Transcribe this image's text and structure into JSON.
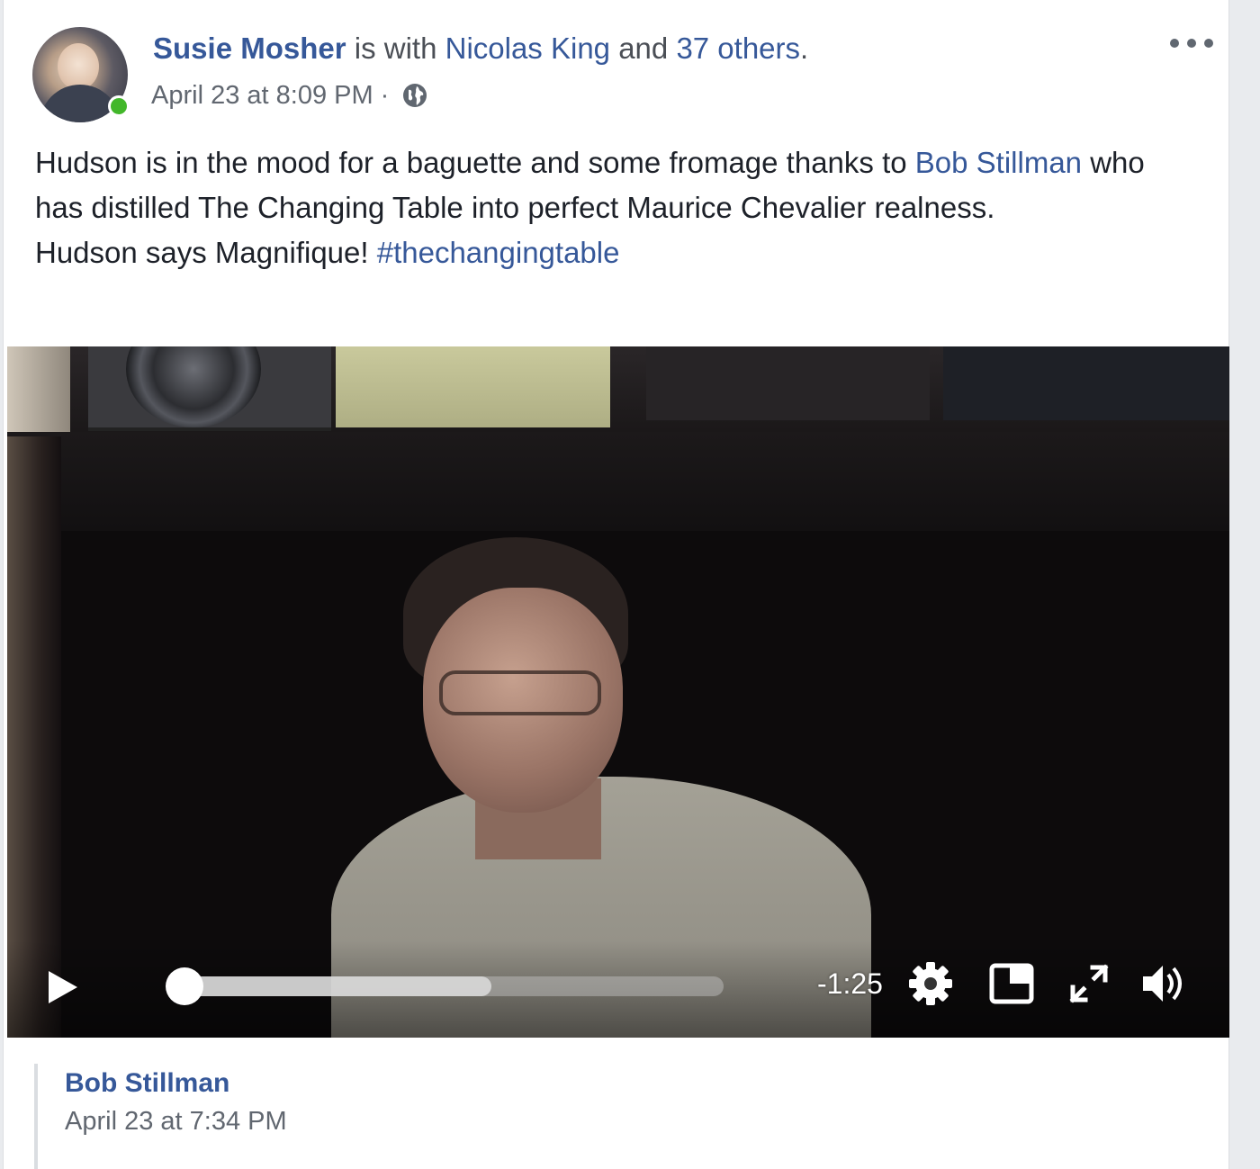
{
  "post": {
    "author": "Susie Mosher",
    "with_text": " is with ",
    "tagged_person": "Nicolas King",
    "and_text": " and ",
    "others_link": "37 others",
    "period": ".",
    "timestamp": "April 23 at 8:09 PM",
    "separator": "·",
    "privacy_icon": "globe-icon",
    "more_icon": "more-options-icon",
    "text": {
      "line1_start": "Hudson is in the mood for a baguette and some fromage thanks to ",
      "mention": "Bob Stillman",
      "line1_end": " who has distilled The Changing Table into perfect Maurice Chevalier realness.",
      "line2_start": "Hudson says Magnifique! ",
      "hashtag": "#thechangingtable"
    }
  },
  "video": {
    "time_remaining": "-1:25",
    "played_fraction": 0.0,
    "buffered_fraction": 0.57,
    "controls": [
      "play-icon",
      "settings-gear-icon",
      "picture-in-picture-icon",
      "fullscreen-icon",
      "volume-icon"
    ]
  },
  "shared": {
    "author": "Bob Stillman",
    "timestamp": "April 23 at 7:34 PM"
  },
  "colors": {
    "link": "#365899",
    "text": "#1d2129",
    "meta": "#616770",
    "online": "#42b72a"
  }
}
